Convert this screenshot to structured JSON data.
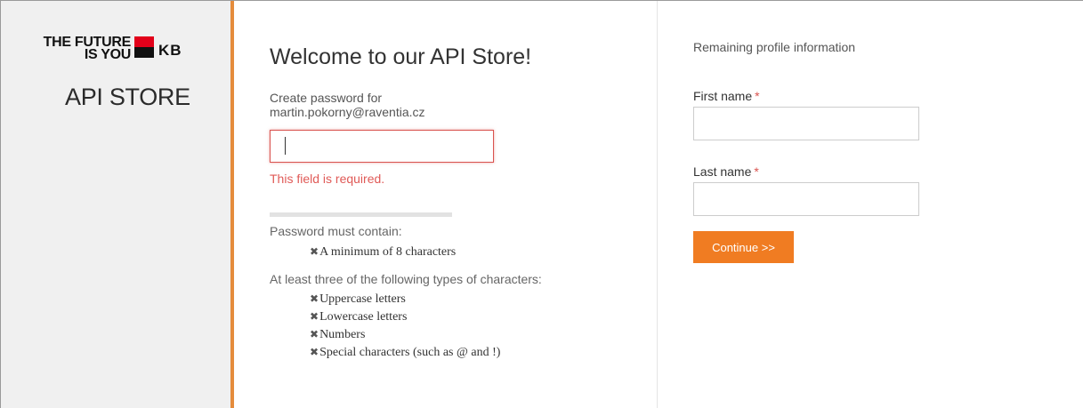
{
  "sidebar": {
    "logo_text_line1": "THE FUTURE",
    "logo_text_line2": "IS YOU",
    "logo_brand": "KB",
    "store_name": "API STORE",
    "accent_color": "#e58c3c"
  },
  "center": {
    "welcome_title": "Welcome to our API Store!",
    "create_label_line1": "Create password for",
    "create_label_line2": "martin.pokorny@raventia.cz",
    "password_value": "",
    "error_text": "This field is required.",
    "strength": 0,
    "rules_title": "Password must contain:",
    "rule_min_length": "A minimum of 8 characters",
    "rules_types_title": "At least three of the following types of characters:",
    "rule_types": [
      "Uppercase letters",
      "Lowercase letters",
      "Numbers",
      "Special characters (such as @ and !)"
    ],
    "rule_icon": "x-mark-icon",
    "error_color": "#d9534f"
  },
  "right": {
    "section_title": "Remaining profile information",
    "first_name_label": "First name",
    "first_name_value": "",
    "last_name_label": "Last name",
    "last_name_value": "",
    "required_marker": "*",
    "continue_label": "Continue >>",
    "button_color": "#f07c22"
  }
}
